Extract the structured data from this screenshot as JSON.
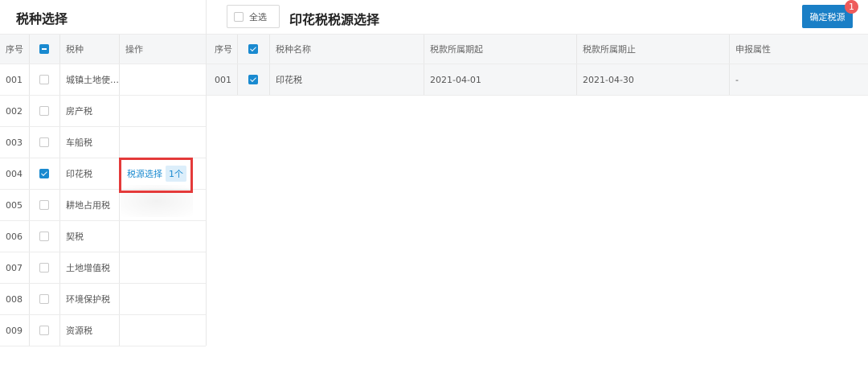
{
  "left": {
    "title": "税种选择",
    "columns": {
      "index": "序号",
      "name": "税种",
      "op": "操作"
    },
    "rows": [
      {
        "index": "001",
        "name": "城镇土地使…",
        "checked": false
      },
      {
        "index": "002",
        "name": "房产税",
        "checked": false
      },
      {
        "index": "003",
        "name": "车船税",
        "checked": false
      },
      {
        "index": "004",
        "name": "印花税",
        "checked": true,
        "op_label": "税源选择",
        "op_count": "1个"
      },
      {
        "index": "005",
        "name": "耕地占用税",
        "checked": false
      },
      {
        "index": "006",
        "name": "契税",
        "checked": false
      },
      {
        "index": "007",
        "name": "土地增值税",
        "checked": false
      },
      {
        "index": "008",
        "name": "环境保护税",
        "checked": false
      },
      {
        "index": "009",
        "name": "资源税",
        "checked": false
      }
    ]
  },
  "right": {
    "select_all_label": "全选",
    "title": "印花税税源选择",
    "confirm_label": "确定税源",
    "confirm_badge": "1",
    "columns": {
      "index": "序号",
      "name": "税种名称",
      "start": "税款所属期起",
      "end": "税款所属期止",
      "attr": "申报属性"
    },
    "rows": [
      {
        "index": "001",
        "name": "印花税",
        "start": "2021-04-01",
        "end": "2021-04-30",
        "attr": "-",
        "checked": true
      }
    ]
  },
  "colors": {
    "accent": "#1a8ad0",
    "highlight": "#e43a3a",
    "badge": "#ee5b5b"
  }
}
